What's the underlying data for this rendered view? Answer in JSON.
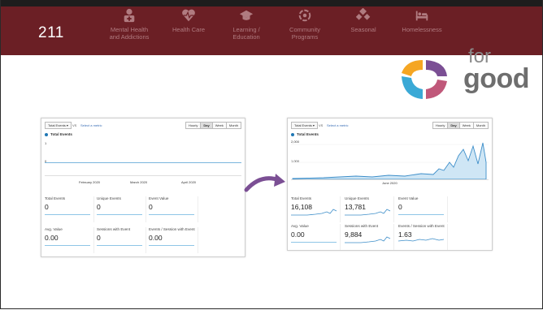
{
  "banner": {
    "number": "211",
    "nav_items": [
      {
        "label": "Mental Health and Addictions",
        "icon": "medical-person-icon"
      },
      {
        "label": "Health Care",
        "icon": "heartbeat-icon"
      },
      {
        "label": "Learning / Education",
        "icon": "graduation-cap-icon"
      },
      {
        "label": "Community Programs",
        "icon": "community-icon"
      },
      {
        "label": "Seasonal",
        "icon": "seasonal-icon"
      },
      {
        "label": "Homelessness",
        "icon": "bed-icon"
      }
    ]
  },
  "logo": {
    "word": "good",
    "prefix": "for"
  },
  "colors": {
    "banner": "#6b1f25",
    "accent": "#1f77b4",
    "arrow": "#7b4f94"
  },
  "before": {
    "dropdown": "Total Events ▾",
    "vs": "VS",
    "select_metric": "Select a metric",
    "granularity": [
      "Hourly",
      "Day",
      "Week",
      "Month"
    ],
    "selected_granularity": "Day",
    "legend": "Total Events",
    "y_top": "1",
    "y_bottom": "0",
    "x_ticks": [
      "February 2020",
      "March 2020",
      "April 2020"
    ],
    "metrics": [
      {
        "label": "Total Events",
        "value": "0"
      },
      {
        "label": "Unique Events",
        "value": "0"
      },
      {
        "label": "Event Value",
        "value": "0"
      },
      {
        "label": "Avg. Value",
        "value": "0.00"
      },
      {
        "label": "Sessions with Event",
        "value": "0"
      },
      {
        "label": "Events / Session with Event",
        "value": "0.00"
      }
    ]
  },
  "after": {
    "dropdown": "Total Events ▾",
    "vs": "VS",
    "select_metric": "Select a metric",
    "granularity": [
      "Hourly",
      "Day",
      "Week",
      "Month"
    ],
    "selected_granularity": "Day",
    "legend": "Total Events",
    "y_top": "2,000",
    "y_mid": "1,000",
    "x_ticks": [
      "June 2020"
    ],
    "metrics": [
      {
        "label": "Total Events",
        "value": "16,108"
      },
      {
        "label": "Unique Events",
        "value": "13,781"
      },
      {
        "label": "Event Value",
        "value": "0"
      },
      {
        "label": "Avg. Value",
        "value": "0.00"
      },
      {
        "label": "Sessions with Event",
        "value": "9,884"
      },
      {
        "label": "Events / Session with Event",
        "value": "1.63"
      }
    ]
  }
}
